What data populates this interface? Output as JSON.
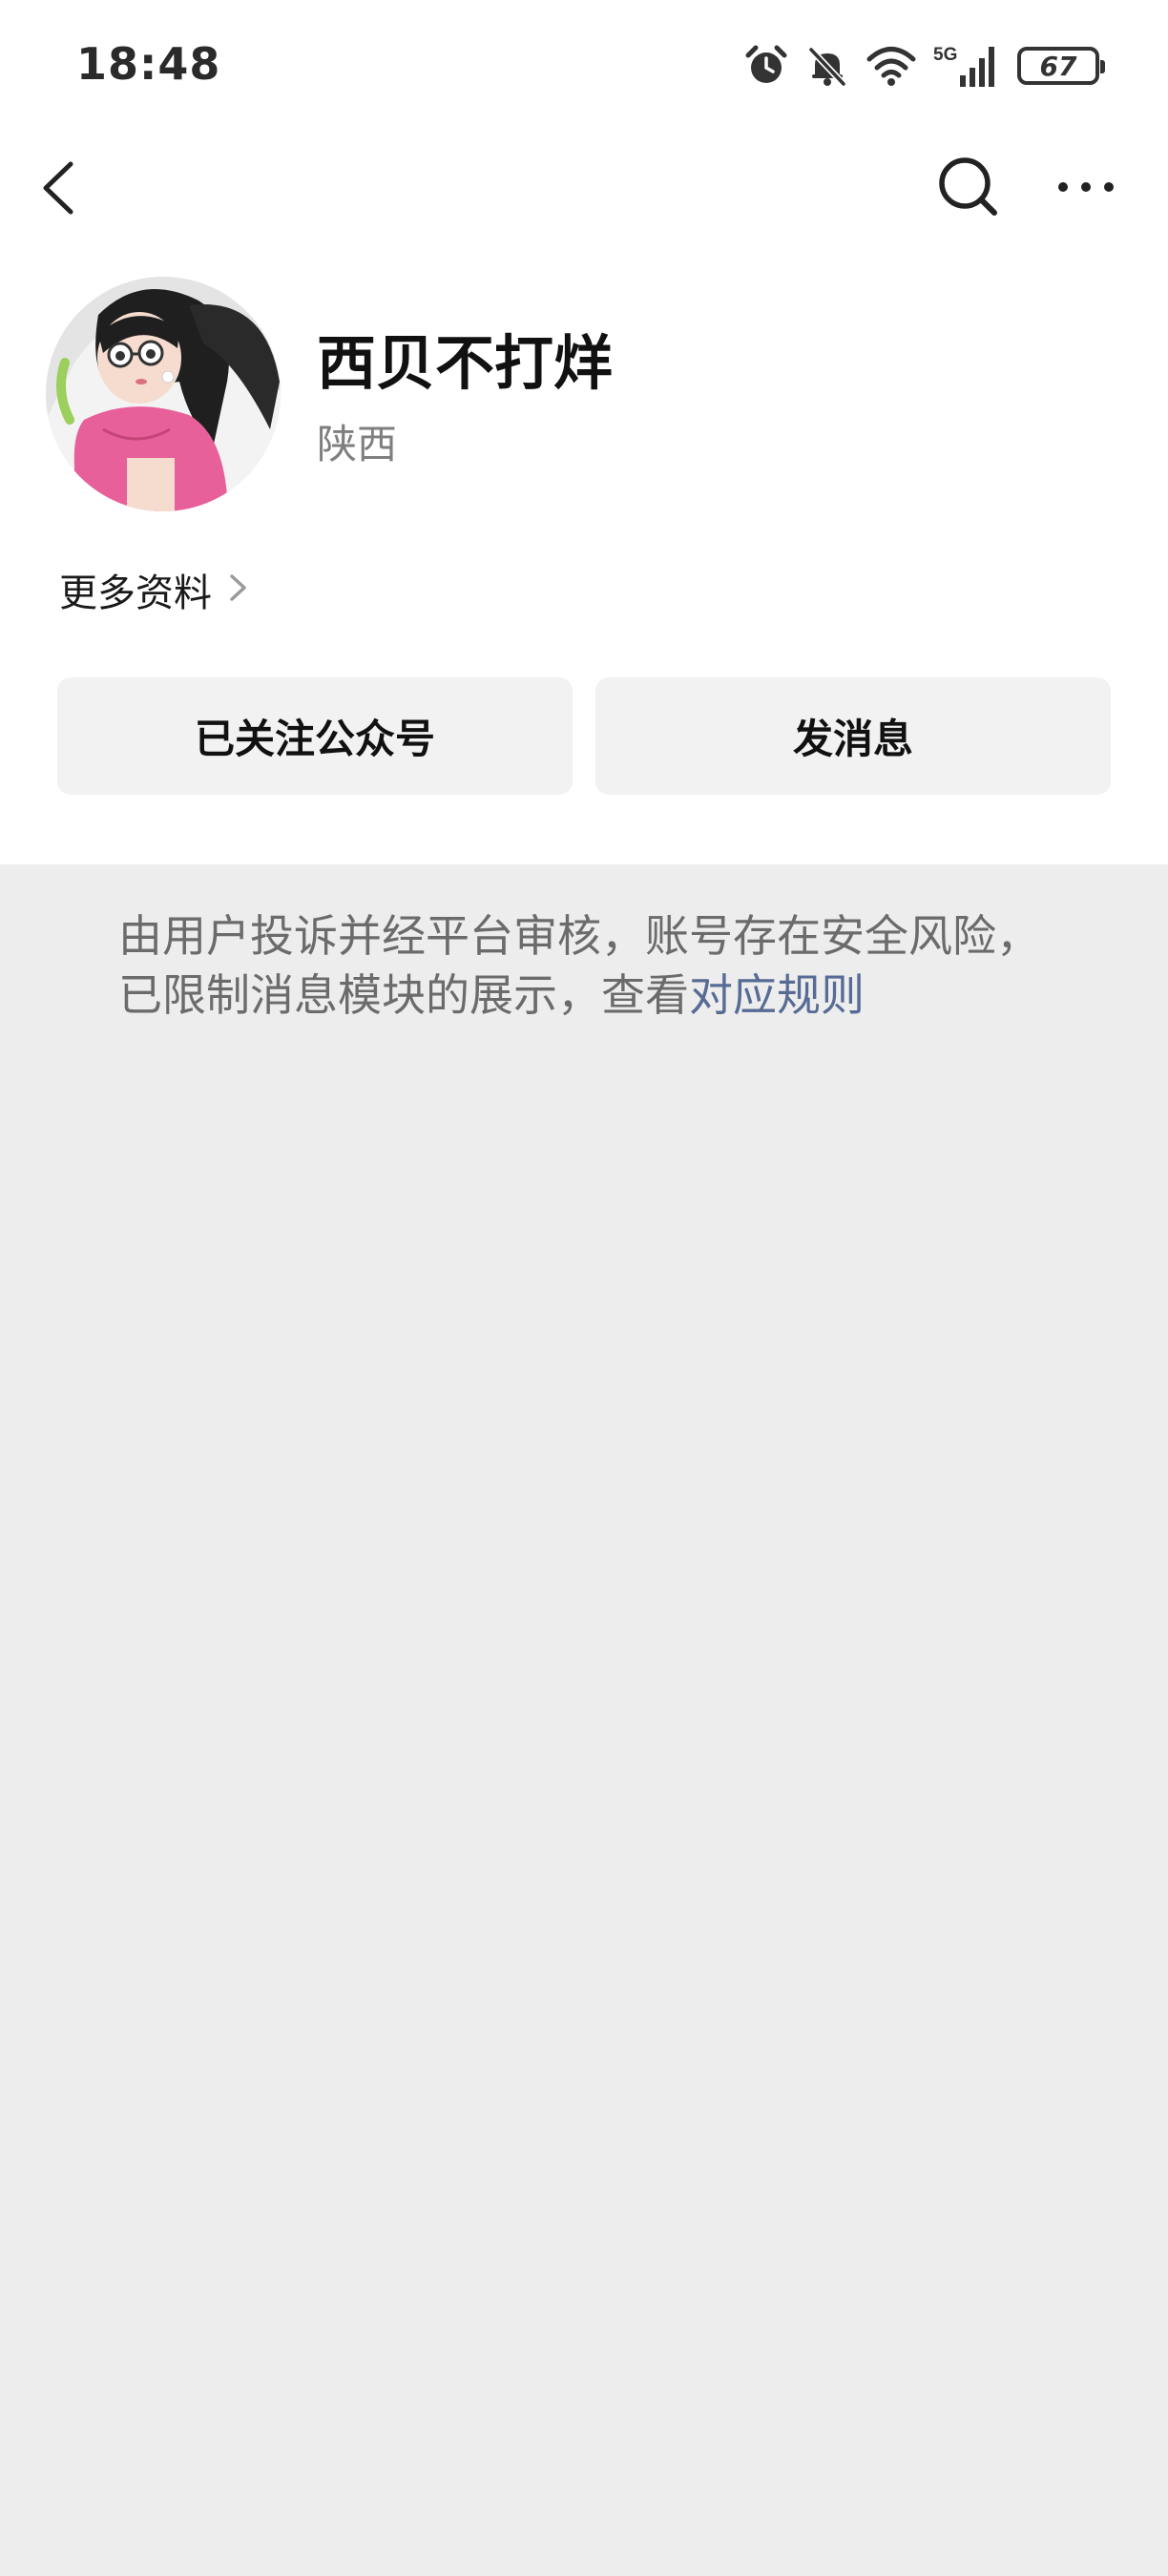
{
  "status_bar": {
    "time": "18:48",
    "battery": "67",
    "network": "5G",
    "icons": [
      "alarm-icon",
      "bell-mute-icon",
      "wifi-icon",
      "signal-icon",
      "battery-icon"
    ]
  },
  "nav": {
    "icons": [
      "back-icon",
      "search-icon",
      "more-icon"
    ]
  },
  "profile": {
    "name": "西贝不打烊",
    "region": "陕西",
    "more_info_label": "更多资料"
  },
  "actions": {
    "follow_label": "已关注公众号",
    "message_label": "发消息"
  },
  "notice": {
    "text": "由用户投诉并经平台审核，账号存在安全风险，已限制消息模块的展示，查看",
    "link_text": "对应规则"
  },
  "colors": {
    "background": "#ededed",
    "panel": "#ffffff",
    "button": "#f2f2f2",
    "link": "#576b95",
    "notice_text": "#6b6b6b"
  }
}
